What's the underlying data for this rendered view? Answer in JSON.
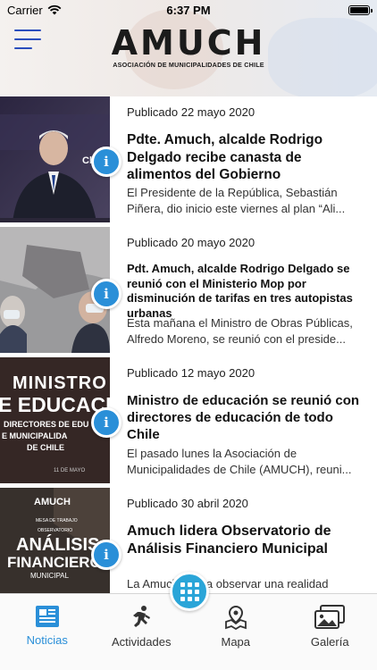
{
  "status_bar": {
    "carrier": "Carrier",
    "time": "6:37 PM"
  },
  "header": {
    "logo_name": "AMUCH",
    "logo_subtitle": "ASOCIACIÓN DE MUNICIPALIDADES DE CHILE"
  },
  "news": [
    {
      "date": "Publicado 22 mayo 2020",
      "title": "Pdte. Amuch, alcalde Rodrigo Delgado recibe canasta de alimentos del Gobierno",
      "excerpt_line1": "El Presidente de la República, Sebastián",
      "excerpt_line2": "Piñera, dio inicio este viernes al plan  “Ali...",
      "thumb_text": "Chile"
    },
    {
      "date": "Publicado 20 mayo 2020",
      "title": "Pdt. Amuch, alcalde Rodrigo Delgado se reunió con el Ministerio Mop por disminución de tarifas en tres autopistas urbanas",
      "excerpt_line1": "Esta mañana el Ministro de Obras Públicas,",
      "excerpt_line2": "Alfredo Moreno, se reunió con el preside..."
    },
    {
      "date": "Publicado 12 mayo 2020",
      "title": "Ministro de educación se reunió con directores de educación de todo Chile",
      "excerpt_line1": "El pasado lunes la Asociación de",
      "excerpt_line2": "Municipalidades de Chile (AMUCH), reuni...",
      "thumb_line1": "MINISTRO",
      "thumb_line2": "E EDUCACIÓ",
      "thumb_line3": "DIRECTORES DE EDU",
      "thumb_line4": "E MUNICIPALIDA",
      "thumb_line5": "DE CHILE",
      "thumb_line6": "11 DE MAYO"
    },
    {
      "date": "Publicado 30 abril 2020",
      "title": "Amuch lidera Observatorio de Análisis Financiero Municipal",
      "excerpt_line1": "La Amuch busca observar una realidad",
      "thumb_line1": "AMUCH",
      "thumb_line2": "MESA DE TRABAJO",
      "thumb_line3": "OBSERVATORIO",
      "thumb_line4": "ANÁLISIS",
      "thumb_line5": "FINANCIERO",
      "thumb_line6": "MUNICIPAL"
    }
  ],
  "tabs": [
    {
      "label": "Noticias",
      "icon": "newspaper-icon",
      "active": true
    },
    {
      "label": "Actividades",
      "icon": "running-person-icon",
      "active": false
    },
    {
      "label": "Mapa",
      "icon": "map-pin-icon",
      "active": false
    },
    {
      "label": "Galería",
      "icon": "photo-gallery-icon",
      "active": false
    }
  ],
  "colors": {
    "accent": "#2a8fd8",
    "menu": "#2a4dbd"
  }
}
